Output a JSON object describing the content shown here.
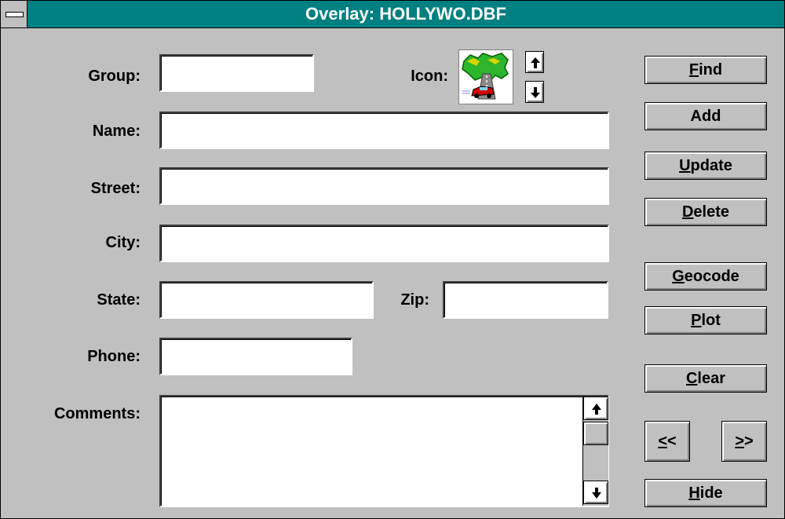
{
  "window": {
    "title": "Overlay: HOLLYWO.DBF"
  },
  "labels": {
    "group": "Group:",
    "icon": "Icon:",
    "name": "Name:",
    "street": "Street:",
    "city": "City:",
    "state": "State:",
    "zip": "Zip:",
    "phone": "Phone:",
    "comments": "Comments:"
  },
  "fields": {
    "group": "",
    "name": "",
    "street": "",
    "city": "",
    "state": "",
    "zip": "",
    "phone": "",
    "comments": ""
  },
  "buttons": {
    "find": {
      "mnemonic": "F",
      "rest": "ind"
    },
    "add": {
      "label": "Add"
    },
    "update": {
      "mnemonic": "U",
      "rest": "pdate"
    },
    "delete": {
      "mnemonic": "D",
      "rest": "elete"
    },
    "geocode": {
      "mnemonic": "G",
      "rest": "eocode"
    },
    "plot": {
      "mnemonic": "P",
      "rest": "lot"
    },
    "clear": {
      "mnemonic": "C",
      "rest": "lear"
    },
    "prev": {
      "mnemonic": "<",
      "rest": "<"
    },
    "next": {
      "mnemonic": ">",
      "rest": ">"
    },
    "hide": {
      "mnemonic": "H",
      "rest": "ide"
    }
  },
  "colors": {
    "titlebar": "#008080",
    "face": "#c0c0c0"
  },
  "icons": {
    "overlay_icon": "map-car-icon"
  }
}
